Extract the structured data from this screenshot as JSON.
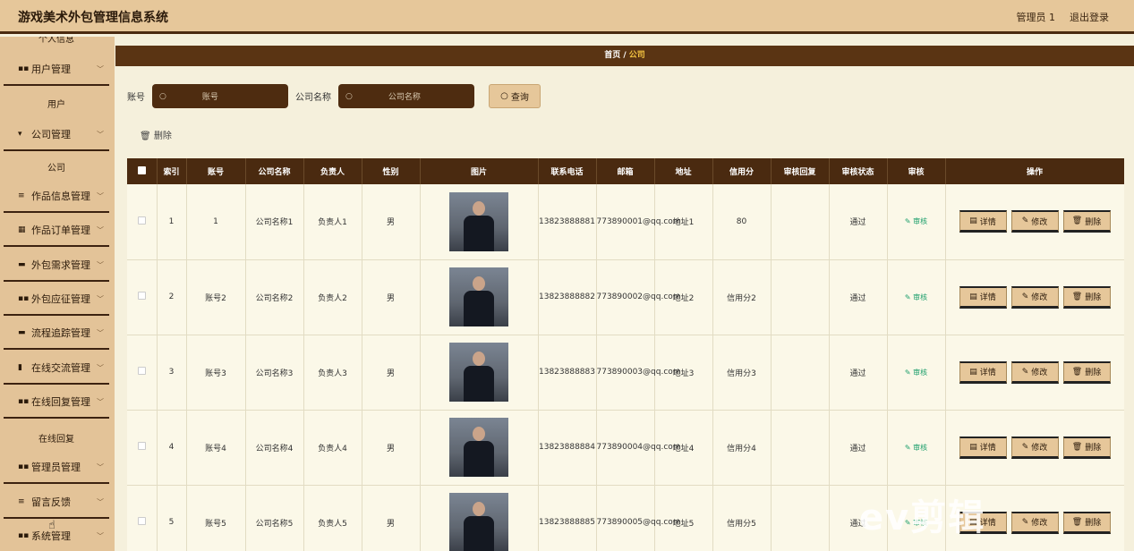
{
  "app": {
    "title": "游戏美术外包管理信息系统",
    "user": "管理员 1",
    "logout": "退出登录"
  },
  "sidebar": {
    "top_partial": "个人信息",
    "items": [
      {
        "label": "用户管理",
        "sub": "用户"
      },
      {
        "label": "公司管理",
        "sub": "公司"
      },
      {
        "label": "作品信息管理"
      },
      {
        "label": "作品订单管理"
      },
      {
        "label": "外包需求管理"
      },
      {
        "label": "外包应征管理"
      },
      {
        "label": "流程追踪管理"
      },
      {
        "label": "在线交流管理"
      },
      {
        "label": "在线回复管理",
        "sub": "在线回复"
      },
      {
        "label": "管理员管理"
      },
      {
        "label": "留言反馈"
      },
      {
        "label": "系统管理"
      }
    ]
  },
  "breadcrumb": {
    "home": "首页",
    "sep": "/",
    "current": "公司"
  },
  "search": {
    "account_label": "账号",
    "account_placeholder": "账号",
    "company_label": "公司名称",
    "company_placeholder": "公司名称",
    "query_button": "查询"
  },
  "toolbar": {
    "delete_label": "删除"
  },
  "table": {
    "headers": [
      "索引",
      "账号",
      "公司名称",
      "负责人",
      "性别",
      "图片",
      "联系电话",
      "邮箱",
      "地址",
      "信用分",
      "审核回复",
      "审核状态",
      "审核",
      "操作"
    ],
    "rows": [
      {
        "index": "1",
        "account": "1",
        "company": "公司名称1",
        "leader": "负责人1",
        "gender": "男",
        "phone": "13823888881",
        "email": "773890001@qq.com",
        "address": "地址1",
        "credit": "80",
        "reply": "",
        "status": "通过",
        "audit": "审核"
      },
      {
        "index": "2",
        "account": "账号2",
        "company": "公司名称2",
        "leader": "负责人2",
        "gender": "男",
        "phone": "13823888882",
        "email": "773890002@qq.com",
        "address": "地址2",
        "credit": "信用分2",
        "reply": "",
        "status": "通过",
        "audit": "审核"
      },
      {
        "index": "3",
        "account": "账号3",
        "company": "公司名称3",
        "leader": "负责人3",
        "gender": "男",
        "phone": "13823888883",
        "email": "773890003@qq.com",
        "address": "地址3",
        "credit": "信用分3",
        "reply": "",
        "status": "通过",
        "audit": "审核"
      },
      {
        "index": "4",
        "account": "账号4",
        "company": "公司名称4",
        "leader": "负责人4",
        "gender": "男",
        "phone": "13823888884",
        "email": "773890004@qq.com",
        "address": "地址4",
        "credit": "信用分4",
        "reply": "",
        "status": "通过",
        "audit": "审核"
      },
      {
        "index": "5",
        "account": "账号5",
        "company": "公司名称5",
        "leader": "负责人5",
        "gender": "男",
        "phone": "13823888885",
        "email": "773890005@qq.com",
        "address": "地址5",
        "credit": "信用分5",
        "reply": "",
        "status": "通过",
        "audit": "审核"
      }
    ],
    "actions": {
      "detail": "详情",
      "edit": "修改",
      "delete": "删除"
    }
  },
  "watermark": "ev剪辑"
}
